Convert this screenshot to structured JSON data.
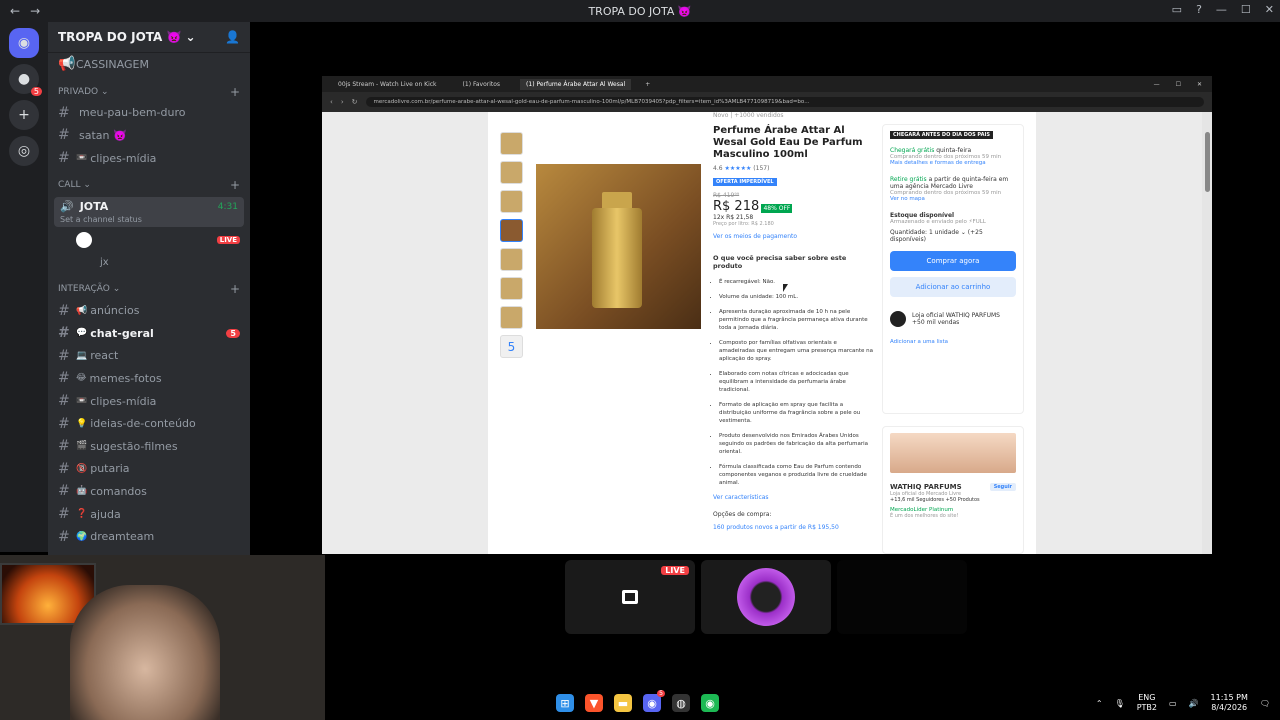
{
  "window": {
    "title": "TROPA DO JOTA 👿",
    "nav_back": "←",
    "nav_forward": "→",
    "controls": [
      "▭",
      "?",
      "—",
      "☐",
      "✕"
    ]
  },
  "rail": {
    "servers": [
      {
        "icon": "discord-icon",
        "glyph": "◉"
      },
      {
        "icon": "server-avatar",
        "glyph": "●",
        "badge": "5"
      },
      {
        "icon": "add-server-icon",
        "glyph": "+"
      },
      {
        "icon": "discover-icon",
        "glyph": "◎"
      }
    ]
  },
  "sidebar": {
    "guild_name": "TROPA DO JOTA 👿",
    "top_channel": "CASSINAGEM",
    "categories": {
      "privado": "PRIVADO",
      "call": "CALL",
      "interacao": "INTERAÇÃO"
    },
    "privado_channels": [
      {
        "label": "meu-pau-bem-duro",
        "emoji": ""
      },
      {
        "label": "satan 👿",
        "emoji": ""
      },
      {
        "label": "clipes-mídia",
        "emoji": "📼"
      }
    ],
    "voice": {
      "name": "JOTA",
      "time": "4:31",
      "status": "Set a channel status",
      "users": [
        {
          "name": "",
          "live": "LIVE"
        },
        {
          "name": "jx",
          "live": ""
        }
      ]
    },
    "interacao_channels": [
      {
        "label": "anúncios",
        "emoji": "📢",
        "bold": false,
        "count": ""
      },
      {
        "label": "chat-geral",
        "emoji": "💬",
        "bold": true,
        "count": "5"
      },
      {
        "label": "react",
        "emoji": "💻",
        "bold": false,
        "count": ""
      },
      {
        "label": "memes-fotos",
        "emoji": "😂",
        "bold": false,
        "count": ""
      },
      {
        "label": "clipes-mídia",
        "emoji": "📼",
        "bold": false,
        "count": ""
      },
      {
        "label": "ideias-de-conteúdo",
        "emoji": "💡",
        "bold": false,
        "count": ""
      },
      {
        "label": "sugestão-filmes",
        "emoji": "🎬",
        "bold": false,
        "count": ""
      },
      {
        "label": "putaria",
        "emoji": "🔞",
        "bold": false,
        "count": ""
      },
      {
        "label": "comandos",
        "emoji": "🤖",
        "bold": false,
        "count": ""
      },
      {
        "label": "ajuda",
        "emoji": "❓",
        "bold": false,
        "count": ""
      },
      {
        "label": "dreamteam",
        "emoji": "🌍",
        "bold": false,
        "count": ""
      }
    ]
  },
  "browser": {
    "tabs": [
      {
        "label": "00js Stream - Watch Live on Kick"
      },
      {
        "label": "(1) Favoritos"
      },
      {
        "label": "(1) Perfume Árabe Attar Al Wesal",
        "active": true
      }
    ],
    "url": "mercadolivre.com.br/perfume-arabe-attar-al-wesal-gold-eau-de-parfum-masculino-100ml/p/MLB7039405?pdp_filters=item_id%3AMLB4771098719&bad=bo...",
    "window_controls": [
      "—",
      "☐",
      "✕"
    ]
  },
  "product": {
    "condition": "Novo  |  +1000 vendidos",
    "title": "Perfume Árabe Attar Al Wesal Gold Eau De Parfum Masculino 100ml",
    "rating": "4.6",
    "stars": "★★★★★",
    "reviews": "(157)",
    "tag": "OFERTA IMPERDÍVEL",
    "old_price": "R$ 419⁹⁹",
    "price": "R$ 218",
    "discount": "48% OFF",
    "installments": "12x R$ 21,58",
    "unit_price": "Preço por litro: R$ 2.180",
    "payment_link": "Ver os meios de pagamento",
    "about_header": "O que você precisa saber sobre este produto",
    "features": [
      "É recarregável: Não.",
      "Volume da unidade: 100 mL.",
      "Apresenta duração aproximada de 10 h na pele permitindo que a fragrância permaneça ativa durante toda a jornada diária.",
      "Composto por famílias olfativas orientais e amadeiradas que entregam uma presença marcante na aplicação do spray.",
      "Elaborado com notas cítricas e adocicadas que equilibram a intensidade da perfumaria árabe tradicional.",
      "Formato de aplicação em spray que facilita a distribuição uniforme da fragrância sobre a pele ou vestimenta.",
      "Produto desenvolvido nos Emirados Árabes Unidos seguindo os padrões de fabricação da alta perfumaria oriental.",
      "Fórmula classificada como Eau de Parfum contendo componentes veganos e produzida livre de crueldade animal."
    ],
    "specs_link": "Ver características",
    "options_header": "Opções de compra:",
    "options_link": "160 produtos novos a partir de R$ 195,50",
    "thumb_more": "5"
  },
  "buybox": {
    "flag": "CHEGARÁ ANTES DO DIA DOS PAIS",
    "ship1": "Chegará grátis",
    "ship1_rest": " quinta-feira",
    "ship1_note": "Comprando dentro dos próximos 59 min",
    "ship1_link": "Mais detalhes e formas de entrega",
    "ship2": "Retire grátis",
    "ship2_rest": " a partir de quinta-feira em uma agência Mercado Livre",
    "ship2_note": "Comprando dentro dos próximos 59 min",
    "ship2_link": "Ver no mapa",
    "stock": "Estoque disponível",
    "stock_note": "Armazenado e enviado pelo ⚡FULL",
    "qty": "Quantidade: 1 unidade ⌄ (+25 disponíveis)",
    "buy": "Comprar agora",
    "cart": "Adicionar ao carrinho",
    "seller": "Loja oficial WATHIQ PARFUMS",
    "seller_sales": "+50 mil vendas",
    "list_link": "Adicionar a uma lista"
  },
  "store": {
    "name": "WATHIQ PARFUMS",
    "follow": "Seguir",
    "subtitle": "Loja oficial do Mercado Livre",
    "followers": "+13,6 mil Seguidores  +50 Produtos",
    "badge": "MercadoLíder Platinum",
    "badge_note": "É um dos melhores do site!"
  },
  "stream_tiles": {
    "live": "LIVE"
  },
  "taskbar": {
    "apps": [
      {
        "name": "windows-start",
        "glyph": "⊞",
        "color": "#2f8fe8"
      },
      {
        "name": "brave",
        "glyph": "▼",
        "color": "#fb542b"
      },
      {
        "name": "file-explorer",
        "glyph": "▬",
        "color": "#f4c542"
      },
      {
        "name": "discord",
        "glyph": "◉",
        "color": "#5865f2",
        "badge": "5"
      },
      {
        "name": "obs",
        "glyph": "◍",
        "color": "#333"
      },
      {
        "name": "spotify",
        "glyph": "◉",
        "color": "#1db954"
      }
    ],
    "lang1": "ENG",
    "lang2": "PTB2",
    "time": "11:15 PM",
    "date": "8/4/2026"
  }
}
